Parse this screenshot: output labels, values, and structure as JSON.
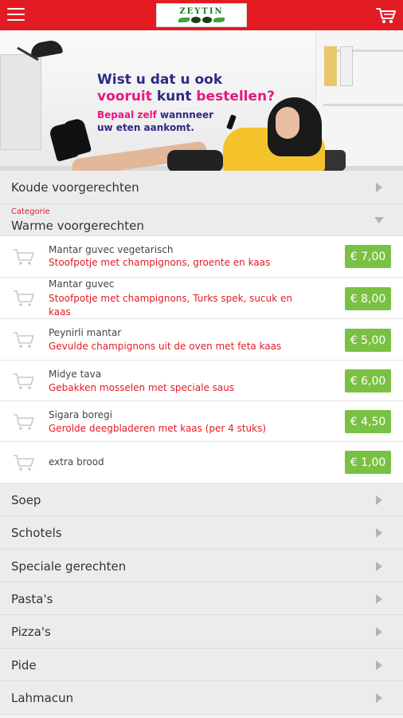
{
  "header": {
    "menu_icon": "hamburger-menu-icon",
    "logo_text": "ZEYTIN",
    "cart_icon": "shopping-cart-icon",
    "brand_color": "#e31b23"
  },
  "banner": {
    "line1": "Wist u dat u ook",
    "line2_a": "vooruit",
    "line2_b": "kunt",
    "line2_c": "bestellen?",
    "line3_a": "Bepaal zelf",
    "line3_b": "wannneer",
    "line4": "uw eten aankomt."
  },
  "categories_top": [
    {
      "label": "Koude voorgerechten"
    }
  ],
  "open_category": {
    "sublabel": "Categorie",
    "label": "Warme voorgerechten"
  },
  "items": [
    {
      "name": "Mantar guvec vegetarisch",
      "desc": "Stoofpotje met champignons, groente en kaas",
      "price": "€ 7,00"
    },
    {
      "name": "Mantar guvec",
      "desc": "Stoofpotje met champignons, Turks spek, sucuk en kaas",
      "price": "€ 8,00"
    },
    {
      "name": "Peynirli mantar",
      "desc": "Gevulde champignons uit de oven met feta kaas",
      "price": "€ 5,00"
    },
    {
      "name": "Midye tava",
      "desc": "Gebakken mosselen met speciale saus",
      "price": "€ 6,00"
    },
    {
      "name": "Sigara boregi",
      "desc": "Gerolde deegbladeren met kaas (per 4 stuks)",
      "price": "€ 4,50"
    },
    {
      "name": "extra brood",
      "desc": "",
      "price": "€ 1,00"
    }
  ],
  "categories_bottom": [
    {
      "label": "Soep"
    },
    {
      "label": "Schotels"
    },
    {
      "label": "Speciale gerechten"
    },
    {
      "label": "Pasta's"
    },
    {
      "label": "Pizza's"
    },
    {
      "label": "Pide"
    },
    {
      "label": "Lahmacun"
    }
  ],
  "colors": {
    "price_bg": "#7ac143",
    "desc_text": "#e31b23",
    "promo_navy": "#2b2a86",
    "promo_pink": "#e6197e"
  }
}
